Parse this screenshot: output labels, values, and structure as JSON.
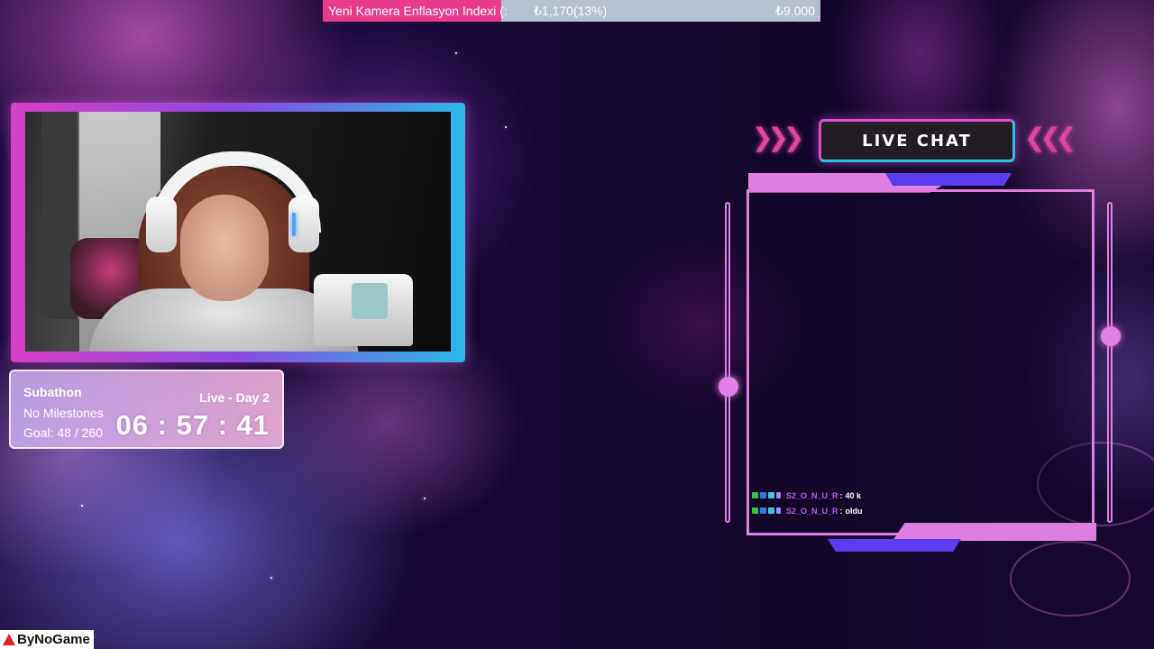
{
  "ticker": {
    "title": "Yeni Kamera Enflasyon Indexi (:",
    "price": "₺1,170(13%)",
    "goal": "₺9,000"
  },
  "subathon": {
    "title": "Subathon",
    "milestones": "No Milestones",
    "goal": "Goal: 48 / 260",
    "live_label": "Live - Day 2",
    "timer": "06 : 57 : 41"
  },
  "chat": {
    "header": "LIVE CHAT",
    "messages": [
      {
        "user": "S2_O_N_U_R",
        "text": "40 k"
      },
      {
        "user": "S2_O_N_U_R",
        "text": "oldu"
      }
    ]
  },
  "logo": {
    "text": "ByNoGame"
  },
  "colors": {
    "accent_pink": "#e07fe3",
    "accent_blue": "#5b3cf0",
    "ticker_pink": "#e83c8a",
    "cyan": "#31c0e8"
  }
}
